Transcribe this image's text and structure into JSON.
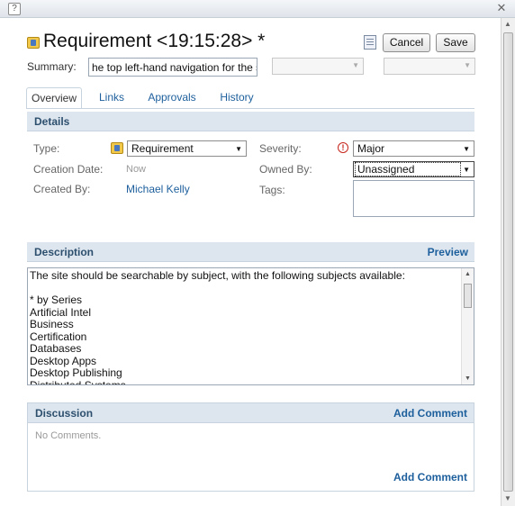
{
  "window": {
    "help_glyph": "?",
    "close_glyph": "✕"
  },
  "header": {
    "title": "Requirement <19:15:28> *",
    "cancel_label": "Cancel",
    "save_label": "Save"
  },
  "summary": {
    "label": "Summary:",
    "value": "he top left-hand navigation for the site"
  },
  "tabs": [
    "Overview",
    "Links",
    "Approvals",
    "History"
  ],
  "details": {
    "heading": "Details",
    "type_label": "Type:",
    "type_value": "Requirement",
    "creation_date_label": "Creation Date:",
    "creation_date_value": "Now",
    "created_by_label": "Created By:",
    "created_by_value": "Michael Kelly",
    "severity_label": "Severity:",
    "severity_value": "Major",
    "owned_by_label": "Owned By:",
    "owned_by_value": "Unassigned",
    "tags_label": "Tags:"
  },
  "description": {
    "heading": "Description",
    "preview_link": "Preview",
    "text": "The site should be searchable by subject, with the following subjects available:\n\n* by Series\nArtificial Intel\nBusiness\nCertification\nDatabases\nDesktop Apps\nDesktop Publishing\nDistributed Systems"
  },
  "discussion": {
    "heading": "Discussion",
    "add_comment_top": "Add Comment",
    "empty_text": "No Comments.",
    "add_comment_bottom": "Add Comment"
  },
  "colors": {
    "accent_link": "#1d5f9c",
    "section_header_bg": "#dde6ef",
    "severity_icon": "#c6251b"
  }
}
